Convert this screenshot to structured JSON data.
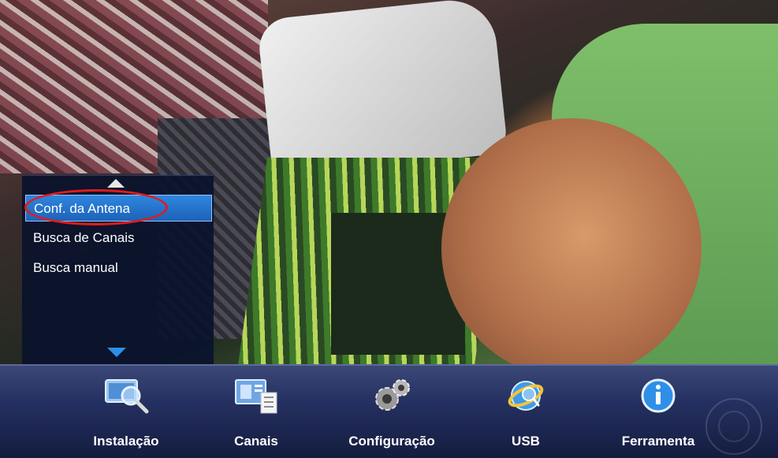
{
  "side_menu": {
    "items": [
      {
        "label": "Conf. da Antena",
        "selected": true
      },
      {
        "label": "Busca de Canais",
        "selected": false
      },
      {
        "label": "Busca manual",
        "selected": false
      }
    ]
  },
  "bottom_bar": {
    "items": [
      {
        "label": "Instalação",
        "icon": "antenna-search-icon"
      },
      {
        "label": "Canais",
        "icon": "channel-list-icon"
      },
      {
        "label": "Configuração",
        "icon": "gears-icon"
      },
      {
        "label": "USB",
        "icon": "usb-globe-icon"
      },
      {
        "label": "Ferramenta",
        "icon": "info-icon"
      }
    ]
  },
  "colors": {
    "selection": "#2f86df",
    "highlight_oval": "#e01c1c",
    "bar": "#243060"
  }
}
